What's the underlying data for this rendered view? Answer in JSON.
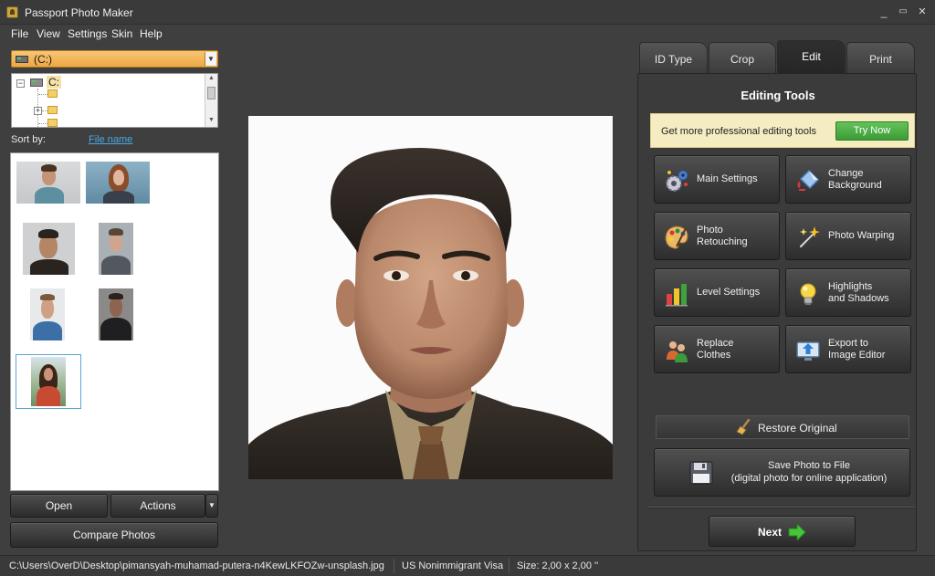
{
  "window": {
    "title": "Passport Photo Maker",
    "min": "_",
    "max": "▭",
    "close": "✕"
  },
  "menu": [
    "File",
    "View",
    "Settings",
    "Skin",
    "Help"
  ],
  "browser": {
    "drive": "(C:)",
    "tree_root": "C:",
    "sort_label": "Sort by:",
    "sort_value": "File name"
  },
  "left_buttons": {
    "open": "Open",
    "actions": "Actions",
    "compare": "Compare Photos"
  },
  "tabs": [
    "ID Type",
    "Crop",
    "Edit",
    "Print"
  ],
  "active_tab": "Edit",
  "editing": {
    "title": "Editing Tools",
    "promo_text": "Get more professional editing tools",
    "try_now": "Try Now",
    "tools": [
      {
        "label": "Main Settings",
        "icon": "gears-icon"
      },
      {
        "label": "Change\nBackground",
        "icon": "paint-bucket-icon"
      },
      {
        "label": "Photo\nRetouching",
        "icon": "palette-icon"
      },
      {
        "label": "Photo Warping",
        "icon": "magic-wand-icon"
      },
      {
        "label": "Level Settings",
        "icon": "bar-levels-icon"
      },
      {
        "label": "Highlights\nand Shadows",
        "icon": "light-bulb-icon"
      },
      {
        "label": "Replace\nClothes",
        "icon": "people-icon"
      },
      {
        "label": "Export to\nImage Editor",
        "icon": "monitor-upload-icon"
      }
    ],
    "restore": "Restore Original",
    "save_line1": "Save Photo to File",
    "save_line2": "(digital photo for online application)",
    "next": "Next"
  },
  "status": {
    "path": "C:\\Users\\OverD\\Desktop\\pimansyah-muhamad-putera-n4KewLKFOZw-unsplash.jpg",
    "id_type": "US Nonimmigrant Visa",
    "size": "Size: 2,00 x 2,00 ''"
  },
  "colors": {
    "accent_orange": "#eda843",
    "try_green": "#4caf42",
    "link_blue": "#4aa8e8",
    "selection_blue": "#5aa6d8"
  }
}
